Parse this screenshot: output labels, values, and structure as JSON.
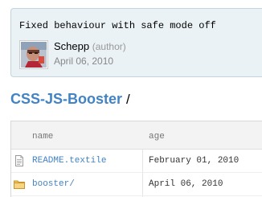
{
  "commit": {
    "message": "Fixed behaviour with safe mode off",
    "author_name": "Schepp",
    "author_role": "(author)",
    "date": "April 06, 2010",
    "avatar_icon": "user-avatar-photo"
  },
  "breadcrumb": {
    "repo": "CSS-JS-Booster",
    "separator": "/"
  },
  "tree": {
    "columns": [
      "name",
      "age"
    ],
    "rows": [
      {
        "name": "README.textile",
        "age": "February 01, 2010",
        "icon": "file-text-icon"
      },
      {
        "name": "booster/",
        "age": "April 06, 2010",
        "icon": "folder-icon"
      }
    ]
  },
  "colors": {
    "link": "#4183c4",
    "commit_bg": "#eaf2f5",
    "folder": "#e8b54a"
  }
}
